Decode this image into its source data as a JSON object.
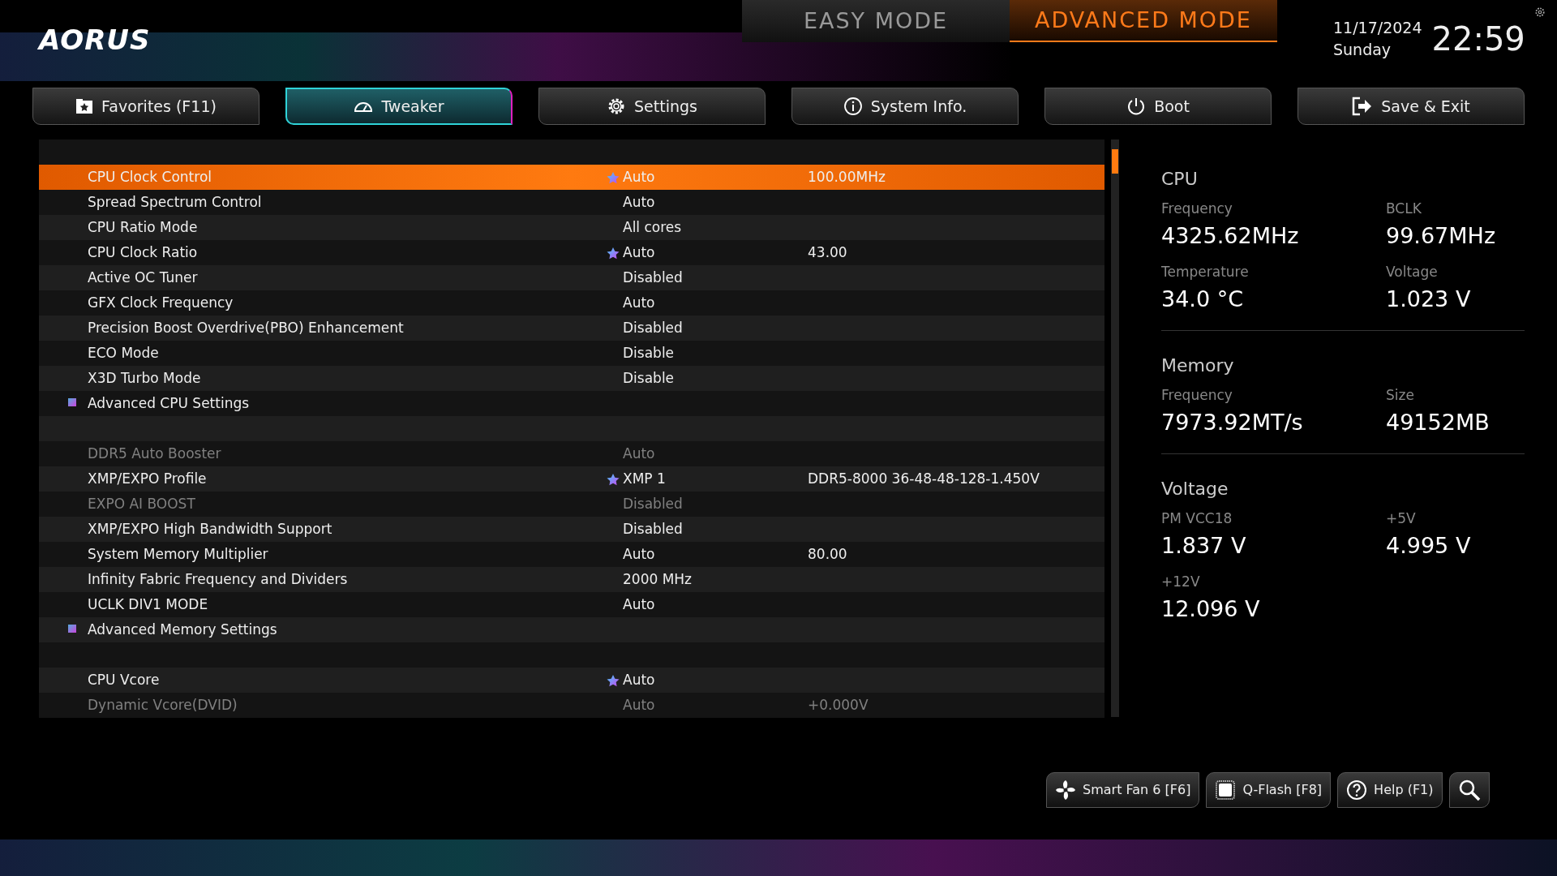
{
  "brand": "AORUS",
  "modes": [
    {
      "label": "EASY MODE",
      "selected": false
    },
    {
      "label": "ADVANCED MODE",
      "selected": true
    }
  ],
  "date": "11/17/2024",
  "weekday": "Sunday",
  "time": "22:59",
  "tabs": [
    {
      "label": "Favorites (F11)",
      "selected": false
    },
    {
      "label": "Tweaker",
      "selected": true
    },
    {
      "label": "Settings",
      "selected": false
    },
    {
      "label": "System Info.",
      "selected": false
    },
    {
      "label": "Boot",
      "selected": false
    },
    {
      "label": "Save & Exit",
      "selected": false
    }
  ],
  "rows": [
    {
      "kind": "spacer"
    },
    {
      "kind": "item",
      "name": "CPU Clock Control",
      "value": "Auto",
      "extra": "100.00MHz",
      "starred": true,
      "selected": true,
      "disabled": false
    },
    {
      "kind": "item",
      "name": "Spread Spectrum Control",
      "value": "Auto",
      "starred": false,
      "selected": false,
      "disabled": false
    },
    {
      "kind": "item",
      "name": "CPU Ratio Mode",
      "value": "All cores",
      "starred": false,
      "selected": false,
      "disabled": false
    },
    {
      "kind": "item",
      "name": "CPU Clock Ratio",
      "value": "Auto",
      "extra": "43.00",
      "starred": true,
      "selected": false,
      "disabled": false
    },
    {
      "kind": "item",
      "name": "Active OC Tuner",
      "value": "Disabled",
      "starred": false,
      "selected": false,
      "disabled": false
    },
    {
      "kind": "item",
      "name": "GFX Clock Frequency",
      "value": "Auto",
      "starred": false,
      "selected": false,
      "disabled": false
    },
    {
      "kind": "item",
      "name": "Precision Boost Overdrive(PBO) Enhancement",
      "value": "Disabled",
      "starred": false,
      "selected": false,
      "disabled": false
    },
    {
      "kind": "item",
      "name": "ECO Mode",
      "value": "Disable",
      "starred": false,
      "selected": false,
      "disabled": false
    },
    {
      "kind": "item",
      "name": "X3D Turbo Mode",
      "value": "Disable",
      "starred": false,
      "selected": false,
      "disabled": false
    },
    {
      "kind": "submenu",
      "name": "Advanced CPU Settings",
      "selected": false
    },
    {
      "kind": "spacer"
    },
    {
      "kind": "item",
      "name": "DDR5 Auto Booster",
      "value": "Auto",
      "starred": false,
      "selected": false,
      "disabled": true
    },
    {
      "kind": "item",
      "name": "XMP/EXPO Profile",
      "value": "XMP 1",
      "extra": "DDR5-8000 36-48-48-128-1.450V",
      "starred": true,
      "selected": false,
      "disabled": false
    },
    {
      "kind": "item",
      "name": "EXPO AI BOOST",
      "value": "Disabled",
      "starred": false,
      "selected": false,
      "disabled": true
    },
    {
      "kind": "item",
      "name": "XMP/EXPO High Bandwidth Support",
      "value": "Disabled",
      "starred": false,
      "selected": false,
      "disabled": false
    },
    {
      "kind": "item",
      "name": "System Memory Multiplier",
      "value": "Auto",
      "extra": "80.00",
      "starred": false,
      "selected": false,
      "disabled": false
    },
    {
      "kind": "item",
      "name": "Infinity Fabric Frequency and Dividers",
      "value": "2000 MHz",
      "starred": false,
      "selected": false,
      "disabled": false
    },
    {
      "kind": "item",
      "name": "UCLK DIV1 MODE",
      "value": "Auto",
      "starred": false,
      "selected": false,
      "disabled": false
    },
    {
      "kind": "submenu",
      "name": "Advanced Memory Settings",
      "selected": false
    },
    {
      "kind": "spacer"
    },
    {
      "kind": "item",
      "name": "CPU Vcore",
      "value": "Auto",
      "starred": true,
      "selected": false,
      "disabled": false
    },
    {
      "kind": "item",
      "name": "Dynamic Vcore(DVID)",
      "value": "Auto",
      "extra": "+0.000V",
      "starred": false,
      "selected": false,
      "disabled": true
    }
  ],
  "monitor": [
    {
      "title": "CPU",
      "stats": [
        {
          "label": "Frequency",
          "value": "4325.62MHz"
        },
        {
          "label": "BCLK",
          "value": "99.67MHz"
        },
        {
          "label": "Temperature",
          "value": "34.0 °C"
        },
        {
          "label": "Voltage",
          "value": "1.023 V"
        }
      ]
    },
    {
      "title": "Memory",
      "stats": [
        {
          "label": "Frequency",
          "value": "7973.92MT/s"
        },
        {
          "label": "Size",
          "value": "49152MB"
        }
      ]
    },
    {
      "title": "Voltage",
      "stats": [
        {
          "label": "PM VCC18",
          "value": "1.837 V"
        },
        {
          "label": "+5V",
          "value": "4.995 V"
        },
        {
          "label": "+12V",
          "value": "12.096 V"
        }
      ]
    }
  ],
  "tools": [
    {
      "label": "Smart Fan 6 [F6]"
    },
    {
      "label": "Q-Flash [F8]"
    },
    {
      "label": "Help (F1)"
    },
    {
      "kind": "search"
    }
  ]
}
